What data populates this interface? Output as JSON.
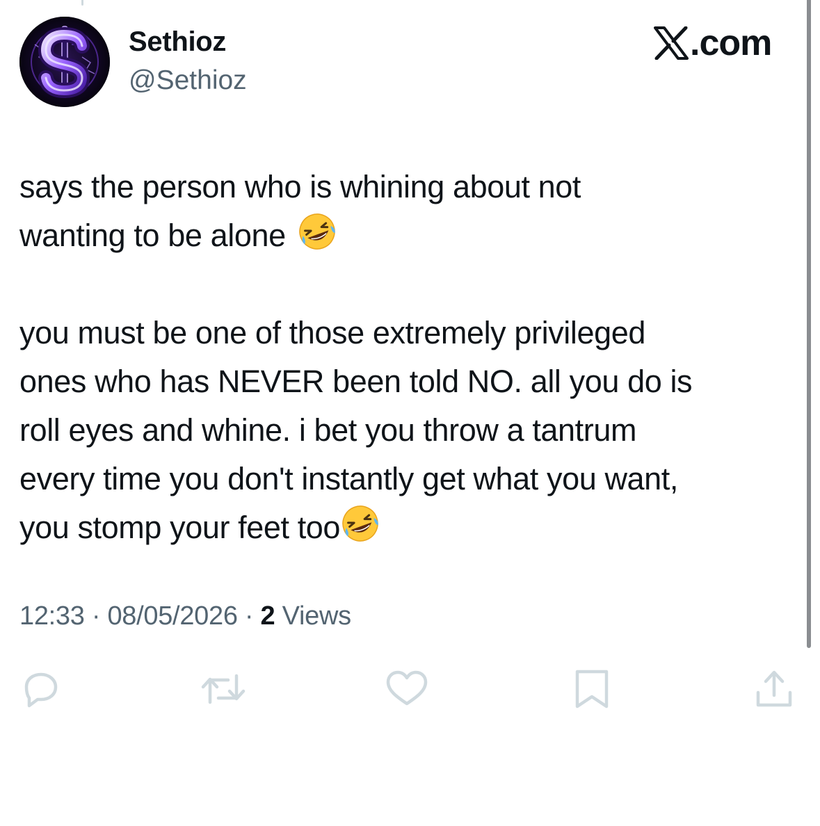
{
  "author": {
    "display_name": "Sethioz",
    "handle": "@Sethioz",
    "avatar_icon": "neon-dollar-sign-avatar"
  },
  "brand": {
    "text": ".com",
    "logo_icon": "x-logo-icon"
  },
  "tweet": {
    "paragraph1_line1": "says the person who is whining about not",
    "paragraph1_line2": "wanting to be alone",
    "paragraph2_line1": "you must be one of those extremely privileged",
    "paragraph2_line2": "ones who has NEVER been told NO. all you do is",
    "paragraph2_line3": "roll eyes and whine. i bet you throw a tantrum",
    "paragraph2_line4": "every time you don't instantly get what you want,",
    "paragraph2_line5": "you stomp your feet too",
    "emoji": "rolling-on-the-floor-laughing-emoji"
  },
  "meta": {
    "time": "12:33",
    "separator": " · ",
    "date": "08/05/2026",
    "views_count": "2",
    "views_label": " Views"
  },
  "actions": [
    {
      "name": "reply",
      "icon": "reply-icon"
    },
    {
      "name": "repost",
      "icon": "repost-icon"
    },
    {
      "name": "like",
      "icon": "heart-icon"
    },
    {
      "name": "bookmark",
      "icon": "bookmark-icon"
    },
    {
      "name": "share",
      "icon": "share-icon"
    }
  ],
  "colors": {
    "text_primary": "#0f1419",
    "text_secondary": "#536471",
    "action_icon": "#cfd9de",
    "avatar_glow": "#7b3fe4"
  }
}
